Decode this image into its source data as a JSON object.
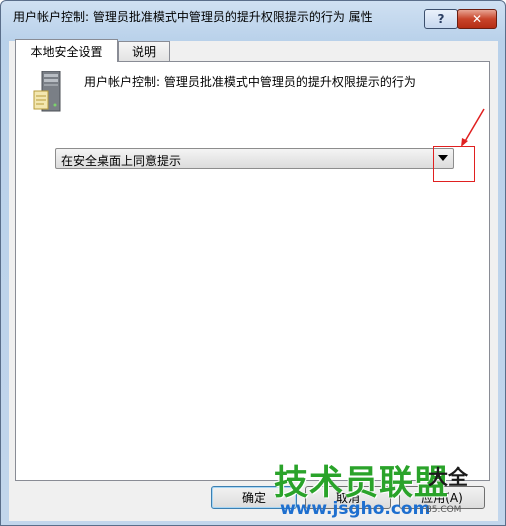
{
  "window": {
    "title": "用户帐户控制: 管理员批准模式中管理员的提升权限提示的行为 属性",
    "help_label": "?",
    "close_label": "✕"
  },
  "tabs": [
    {
      "label": "本地安全设置",
      "active": true
    },
    {
      "label": "说明",
      "active": false
    }
  ],
  "policy": {
    "description": "用户帐户控制: 管理员批准模式中管理员的提升权限提示的行为",
    "icon": "server-policy-icon"
  },
  "dropdown": {
    "selected": "在安全桌面上同意提示"
  },
  "buttons": {
    "ok": "确定",
    "cancel": "取消",
    "apply": "应用(A)"
  },
  "watermark": {
    "main": "技术员联盟",
    "url": "www.jsgho.com",
    "side": "大全",
    "sub": "85.COM"
  },
  "colors": {
    "annotation": "#e02020",
    "watermark_green": "#2aa32a",
    "watermark_blue": "#1e6fcf"
  }
}
